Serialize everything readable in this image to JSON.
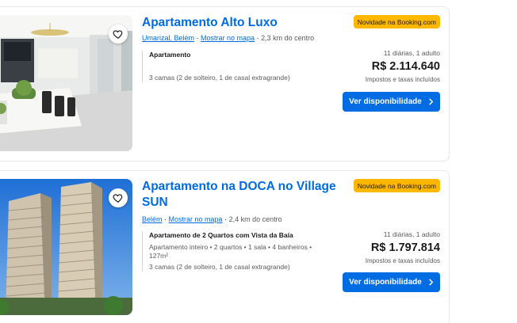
{
  "listings": [
    {
      "title": "Apartamento Alto Luxo",
      "badge": "Novidade na Booking.com",
      "location_link": "Umarizal, Belém",
      "map_link": "Mostrar no mapa",
      "distance": "2,3 km do centro",
      "unit_title": "Apartamento",
      "unit_details": "",
      "beds": "3 camas (2 de solteiro, 1 de casal extragrande)",
      "stay": "11 diárias, 1 adulto",
      "price": "R$ 2.114.640",
      "taxes": "Impostos e taxas incluídos",
      "button": "Ver disponibilidade",
      "favorite_icon": "heart-outline-icon",
      "button_icon": "chevron-right-icon"
    },
    {
      "title": "Apartamento na DOCA no Village SUN",
      "badge": "Novidade na Booking.com",
      "location_link": "Belém",
      "map_link": "Mostrar no mapa",
      "distance": "2,4 km do centro",
      "unit_title": "Apartamento de 2 Quartos com Vista da Baía",
      "unit_details": "Apartamento inteiro • 2 quartos • 1 sala • 4 banheiros • 127m²",
      "beds": "3 camas (2 de solteiro, 1 de casal extragrande)",
      "stay": "11 diárias, 1 adulto",
      "price": "R$ 1.797.814",
      "taxes": "Impostos e taxas incluídos",
      "button": "Ver disponibilidade",
      "favorite_icon": "heart-outline-icon",
      "button_icon": "chevron-right-icon"
    }
  ],
  "colors": {
    "link_blue": "#006ce4",
    "badge_yellow": "#ffb700",
    "text_dark": "#1a1a1a",
    "text_muted": "#595959"
  }
}
